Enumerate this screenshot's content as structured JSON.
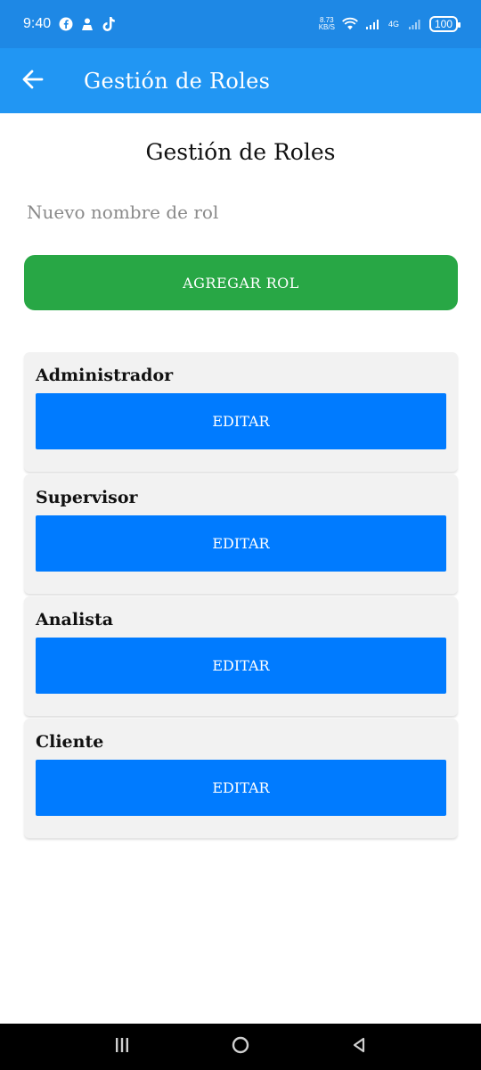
{
  "status_bar": {
    "time": "9:40",
    "net_speed_value": "8.73",
    "net_speed_unit": "KB/S",
    "network_type": "4G",
    "battery": "100",
    "icons": [
      "facebook-icon",
      "person-icon",
      "tiktok-icon",
      "wifi-icon",
      "signal-icon",
      "battery-icon"
    ]
  },
  "app_bar": {
    "title": "Gestión de Roles",
    "back_icon": "arrow-left-icon"
  },
  "main": {
    "title": "Gestión de Roles",
    "input": {
      "placeholder": "Nuevo nombre de rol",
      "value": ""
    },
    "add_button_label": "AGREGAR ROL",
    "roles": [
      {
        "name": "Administrador",
        "edit_label": "EDITAR"
      },
      {
        "name": "Supervisor",
        "edit_label": "EDITAR"
      },
      {
        "name": "Analista",
        "edit_label": "EDITAR"
      },
      {
        "name": "Cliente",
        "edit_label": "EDITAR"
      }
    ]
  },
  "colors": {
    "status_bar": "#1E88E5",
    "app_bar": "#2196F3",
    "add_button": "#28A745",
    "edit_button": "#007BFF",
    "card": "#F2F2F2"
  },
  "nav_bar": {
    "icons": [
      "recents-icon",
      "home-icon",
      "back-triangle-icon"
    ]
  }
}
